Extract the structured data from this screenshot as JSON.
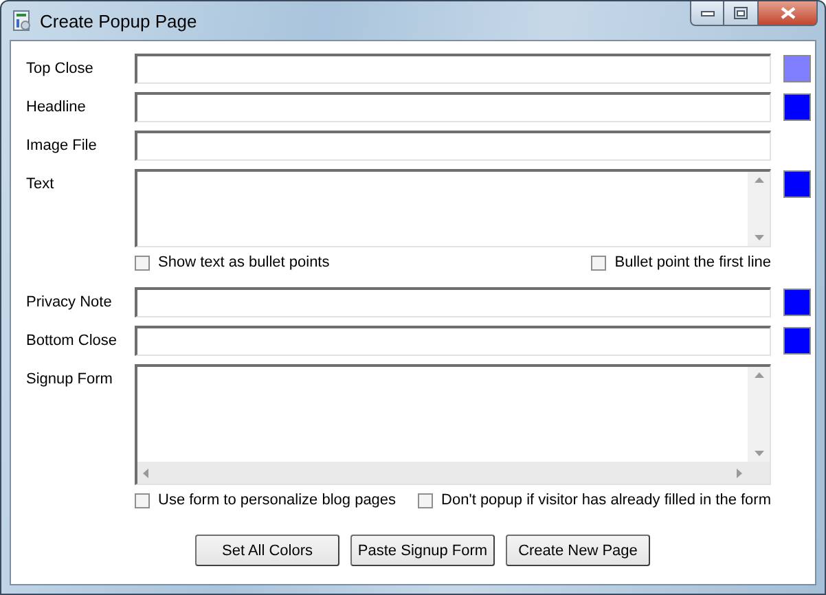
{
  "window": {
    "title": "Create Popup Page"
  },
  "fields": [
    {
      "label": "Top Close",
      "kind": "line",
      "color": "#7f7fff"
    },
    {
      "label": "Headline",
      "kind": "line",
      "color": "#0000ff"
    },
    {
      "label": "Image File",
      "kind": "line"
    },
    {
      "label": "Text",
      "kind": "memo",
      "color": "#0000ff",
      "options": [
        {
          "label": "Show text as bullet points",
          "checked": false
        },
        {
          "label": "Bullet point the first line",
          "checked": false
        }
      ]
    },
    {
      "label": "Privacy Note",
      "kind": "line",
      "color": "#0000ff"
    },
    {
      "label": "Bottom Close",
      "kind": "line",
      "color": "#0000ff"
    },
    {
      "label": "Signup Form",
      "kind": "scrollmemo",
      "options": [
        {
          "label": "Use form to personalize blog pages",
          "checked": false
        },
        {
          "label": "Don't popup if visitor has already filled in the form",
          "checked": false
        }
      ]
    }
  ],
  "buttons": [
    "Set All Colors",
    "Paste Signup Form",
    "Create New Page"
  ]
}
